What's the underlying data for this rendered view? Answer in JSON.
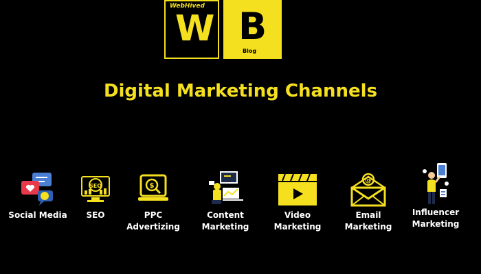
{
  "logo": {
    "brand": "WebHived",
    "letter_w": "W",
    "letter_b": "B",
    "sub": "Blog"
  },
  "title": "Digital Marketing Channels",
  "channels": [
    {
      "label_1": "Social Media",
      "label_2": "",
      "icon": "social-media-icon"
    },
    {
      "label_1": "SEO",
      "label_2": "",
      "icon": "seo-icon"
    },
    {
      "label_1": "PPC",
      "label_2": "Advertizing",
      "icon": "ppc-icon"
    },
    {
      "label_1": "Content",
      "label_2": "Marketing",
      "icon": "content-icon"
    },
    {
      "label_1": "Video",
      "label_2": "Marketing",
      "icon": "video-icon"
    },
    {
      "label_1": "Email",
      "label_2": "Marketing",
      "icon": "email-icon"
    },
    {
      "label_1": "Influencer",
      "label_2": "Marketing",
      "icon": "influencer-icon"
    }
  ],
  "colors": {
    "accent": "#f5e020",
    "background": "#000000",
    "text": "#ffffff"
  }
}
